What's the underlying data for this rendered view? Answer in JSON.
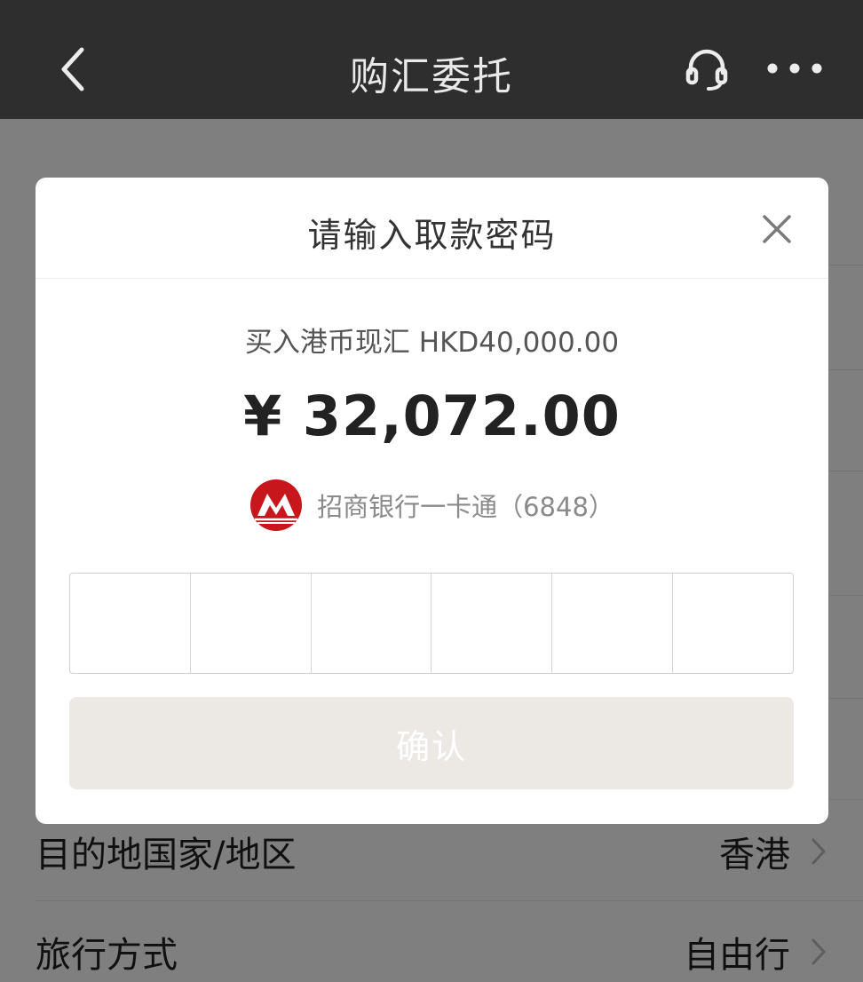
{
  "header": {
    "title": "购汇委托",
    "icons": {
      "back": "chevron-left-icon",
      "service": "headset-icon",
      "more": "more-dots-icon"
    }
  },
  "background": {
    "rows": [
      {
        "label": "目的地国家/地区",
        "value": "香港"
      },
      {
        "label": "旅行方式",
        "value": "自由行"
      }
    ]
  },
  "modal": {
    "title": "请输入取款密码",
    "subtitle": "买入港币现汇 HKD40,000.00",
    "amount": "¥ 32,072.00",
    "card_label": "招商银行一卡通（6848）",
    "pin_length": 6,
    "confirm_label": "确认"
  },
  "colors": {
    "header_bg": "#2e2e2e",
    "overlay": "#7f7f7f",
    "brand_red": "#c8161d",
    "confirm_bg": "#ece9e5"
  }
}
